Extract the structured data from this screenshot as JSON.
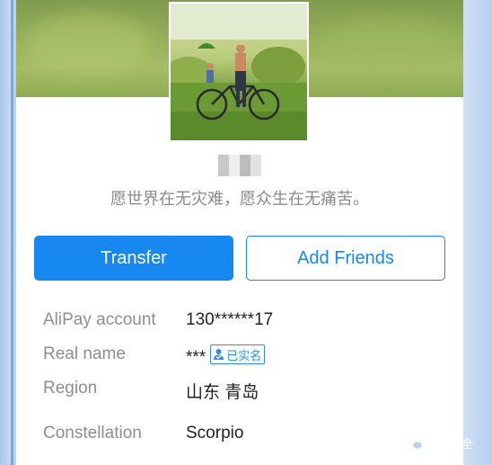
{
  "profile": {
    "motto": "愿世界在无灾难，愿众生在无痛苦。",
    "name_mosaic_colors": [
      "#c8c8c8",
      "#eeeeee",
      "#bdbdbd",
      "#e2e2e2"
    ]
  },
  "actions": {
    "transfer_label": "Transfer",
    "add_friends_label": "Add Friends"
  },
  "details": {
    "alipay_label": "AliPay account",
    "alipay_value": "130******17",
    "realname_label": "Real name",
    "realname_value": "***",
    "verified_badge": "已实名",
    "region_label": "Region",
    "region_value": "山东 青岛",
    "constellation_label": "Constellation",
    "constellation_value": "Scorpio"
  },
  "watermark": {
    "text": "ZAC安全",
    "icon": "wechat-icon"
  },
  "colors": {
    "accent": "#1688f0",
    "badge": "#2d8ee6"
  }
}
